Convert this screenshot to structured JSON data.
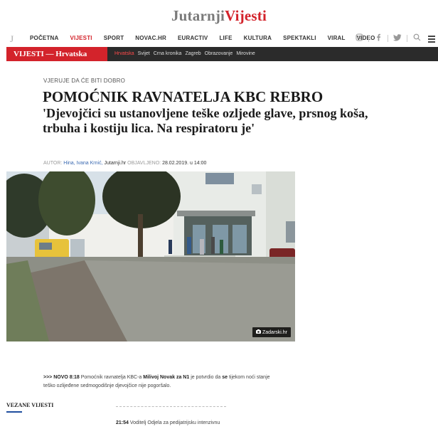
{
  "masthead": {
    "logo_part1": "Jutarnji",
    "logo_part2": "Vijesti"
  },
  "nav": {
    "logo_glyph": "J",
    "items": [
      "POČETNA",
      "VIJESTI",
      "SPORT",
      "NOVAC.HR",
      "EURACTIV",
      "LIFE",
      "KULTURA",
      "SPEKTAKLI",
      "VIRAL",
      "VIDEO"
    ],
    "active": "VIJESTI",
    "icons": [
      "instagram-icon",
      "facebook-icon",
      "twitter-icon",
      "search-icon",
      "menu-icon"
    ]
  },
  "subnav": {
    "section": "VIJESTI — Hrvatska",
    "links": [
      "Hrvatska",
      "Svijet",
      "Crna kronika",
      "Zagreb",
      "Obrazovanje",
      "Mirovine"
    ],
    "active": "Hrvatska"
  },
  "article": {
    "kicker": "VJERUJE DA ĆE BITI DOBRO",
    "title": "POMOĆNIK RAVNATELJA KBC REBRO",
    "subtitle": "'Djevojčici su ustanovljene teške ozljede glave, prsnog koša, trbuha i kostiju lica. Na respiratoru je'",
    "byline": {
      "author_label": "AUTOR:",
      "authors": "Hina, Ivana Krnić,",
      "source": "Jutarnji.hr",
      "published_label": "OBJAVLJENO:",
      "published": "28.02.2019. u 14:00"
    },
    "photo_credit": "Zadarski.hr",
    "update": {
      "prefix": ">>> NOVO 8:18",
      "text1": "Pomoćnik ravnatelja KBC-a",
      "bold1": "Milivoj Novak za N1",
      "text2": "je potvrdio da",
      "bold2": "se",
      "text3": "tijekom noći stanje teško ozlijeđene sedmogodišnje djevojčice nije pogoršalo."
    }
  },
  "related": {
    "title": "VEZANE VIJESTI",
    "items": [
      {
        "time": "21:54",
        "text": "Voditelj Odjela za pedijatrijsku intenzivnu"
      }
    ]
  },
  "colors": {
    "brand_red": "#d3232b",
    "subnav_dark": "#2b2b2b",
    "link_blue": "#3b6ab1",
    "accent_blue": "#1f4e9e"
  }
}
